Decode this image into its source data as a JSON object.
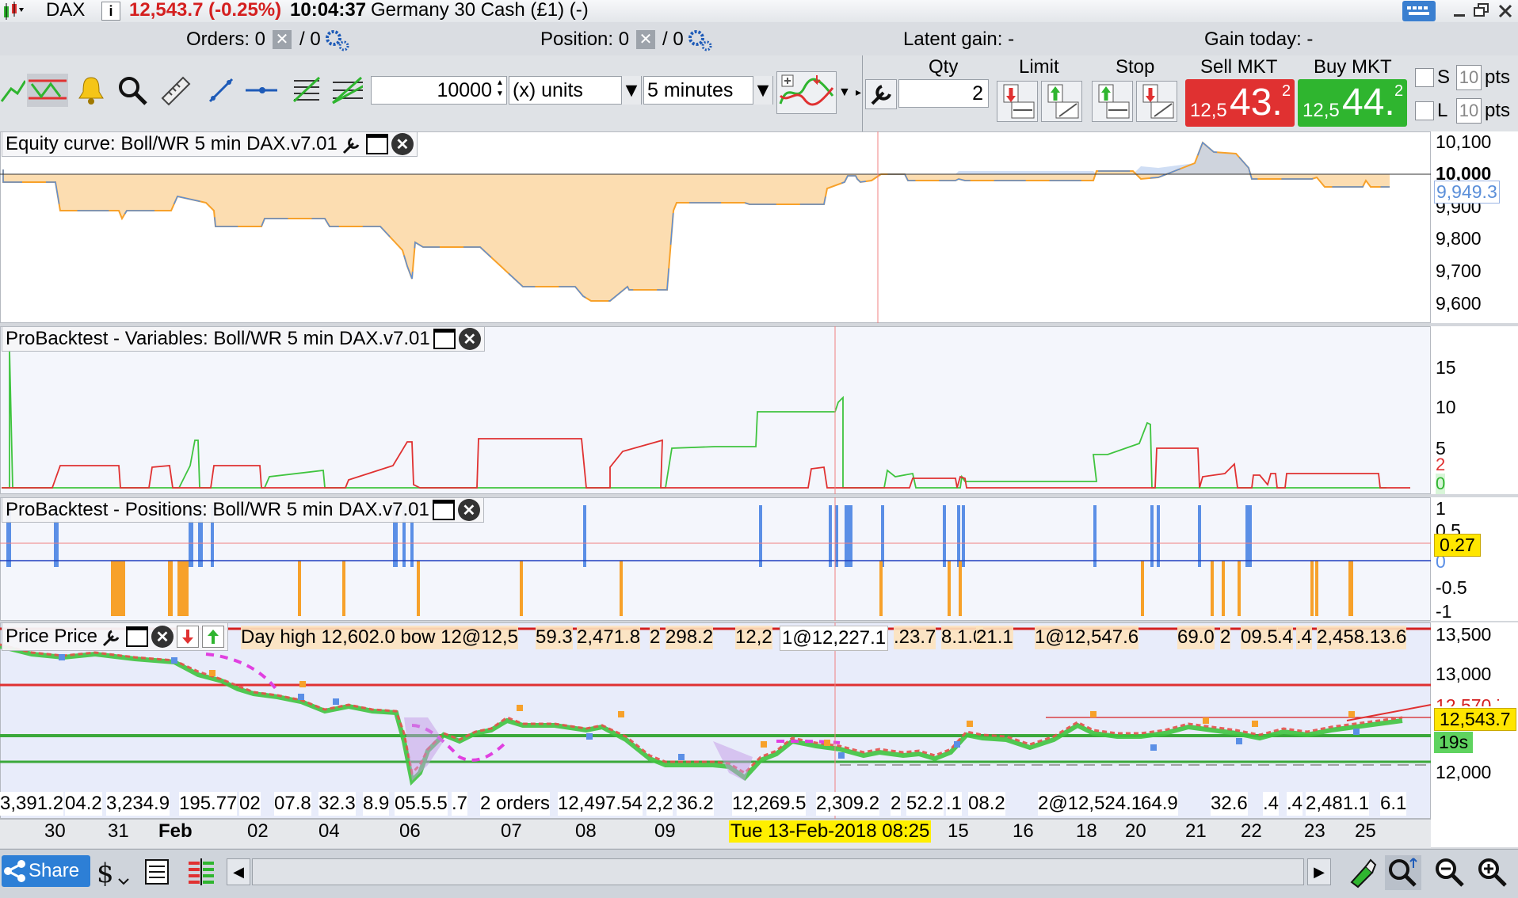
{
  "titlebar": {
    "instrument": "DAX",
    "price": "12,543.7 (-0.25%)",
    "time": "10:04:37",
    "description": "Germany 30 Cash (£1) (-)"
  },
  "status": {
    "orders_label": "Orders: 0",
    "orders_suffix": "/ 0",
    "position_label": "Position: 0",
    "position_suffix": "/ 0",
    "latent_gain": "Latent gain: -",
    "gain_today": "Gain today: -"
  },
  "toolbar": {
    "quantity_value": "10000",
    "units_value": "(x) units",
    "timeframe_value": "5 minutes"
  },
  "order_ticket": {
    "qty_header": "Qty",
    "limit_header": "Limit",
    "stop_header": "Stop",
    "sell_header": "Sell MKT",
    "buy_header": "Buy MKT",
    "qty_value": "2",
    "sell_prefix": "12,5",
    "sell_big": "43.",
    "sell_sup": "2",
    "buy_prefix": "12,5",
    "buy_big": "44.",
    "buy_sup": "2",
    "s_label": "S",
    "l_label": "L",
    "s_pts": "10",
    "l_pts": "10",
    "pts_label": "pts"
  },
  "panels": {
    "equity": {
      "title": "Equity curve: Boll/WR 5 min DAX.v7.01",
      "y_labels": [
        "10,100",
        "10,000",
        "9,900",
        "9,800",
        "9,700",
        "9,600"
      ],
      "current": "9,949.3"
    },
    "variables": {
      "title": "ProBacktest - Variables: Boll/WR 5 min DAX.v7.01",
      "y_labels": [
        "15",
        "10",
        "5"
      ],
      "value_red": "2",
      "value_green": "0"
    },
    "positions": {
      "title": "ProBacktest - Positions: Boll/WR 5 min DAX.v7.01",
      "y_labels": [
        "1",
        "0.5",
        "0",
        "-0.5",
        "-1"
      ],
      "current": "0.27"
    },
    "price": {
      "title": "Price Price",
      "y_labels": [
        "13,500",
        "13,000",
        "12,570.7",
        "12,000"
      ],
      "current": "12,543.7",
      "countdown": "19s",
      "overlay_top": [
        "Day high 12,602.0 bow 12@12,5",
        "59.3",
        "2,471.8",
        "2",
        "298.2",
        "12,2",
        "1@12,227.1",
        ".23.7",
        "8.1.0",
        "21.1",
        "1@12,547.6",
        "69.0",
        "2",
        "09.5",
        ".4",
        ".4",
        "2,458.1",
        "3.6"
      ],
      "overlay_bottom": [
        "3,391.2",
        "04.2",
        "3,234.9",
        "195.77",
        "02",
        "07.8",
        "32.3",
        "8.9",
        "05.5.5",
        ".7",
        "2 orders",
        "12,497.54",
        "2,2",
        "36.2",
        "12,269.5",
        "2,309.2",
        "2",
        "52.2",
        ".1",
        "08.2",
        "2@12,524.1",
        "64.9",
        "32.6",
        ".4",
        ".4",
        "2,481.1",
        "6.1"
      ]
    }
  },
  "dates": [
    "30",
    "31",
    "Feb",
    "02",
    "04",
    "06",
    "07",
    "08",
    "09",
    "Tue 13-Feb-2018 08:25",
    "15",
    "16",
    "18",
    "20",
    "21",
    "22",
    "23",
    "25"
  ],
  "bottombar": {
    "share_label": "Share"
  },
  "colors": {
    "sell": "#e03131",
    "buy": "#2fb52f",
    "equity_fill": "#fcd9a8",
    "equity_line": "#5b8fd9",
    "position_long": "#5b8fe6",
    "position_short": "#f7a12a",
    "crosshair": "#f08080",
    "highlight": "#ffef00"
  }
}
